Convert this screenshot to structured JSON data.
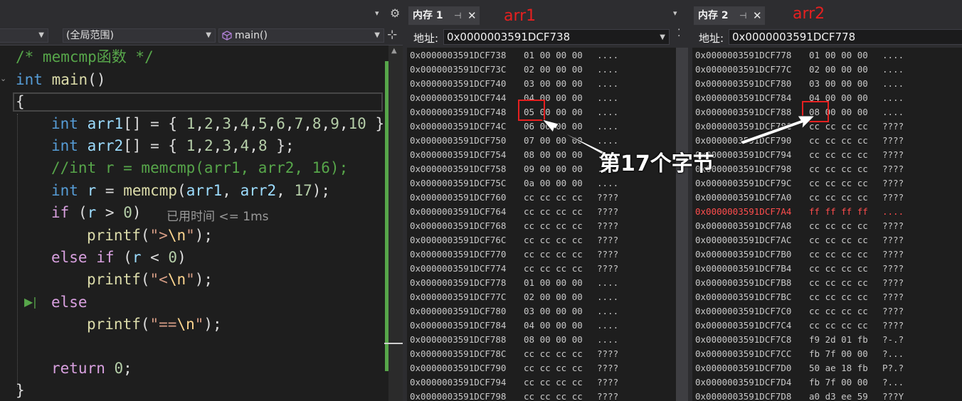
{
  "editor": {
    "scope_dropdown": "(全局范围)",
    "function_dropdown": "main()",
    "code_lines": [
      "/* memcmp函数 */",
      "int main()",
      "{",
      "int arr1[] = { 1,2,3,4,5,6,7,8,9,10 };",
      "int arr2[] = { 1,2,3,4,8 };",
      "//int r = memcmp(arr1, arr2, 16);",
      "int r = memcmp(arr1, arr2, 17);",
      "if (r > 0)",
      "printf(\">\\n\");",
      "else if (r < 0)",
      "printf(\"<\\n\");",
      "else",
      "printf(\"==\\n\");",
      "",
      "return 0;",
      "}"
    ],
    "perf_tip": "已用时间 <= 1ms",
    "current_line_marker": "▶|"
  },
  "memory1": {
    "tab_label": "内存 1",
    "pin": "⊣",
    "close": "✕",
    "address_label": "地址:",
    "address_value": "0x0000003591DCF738",
    "annotation": "arr1",
    "rows": [
      {
        "addr": "0x0000003591DCF738",
        "hex": "01 00 00 00",
        "ascii": "...."
      },
      {
        "addr": "0x0000003591DCF73C",
        "hex": "02 00 00 00",
        "ascii": "...."
      },
      {
        "addr": "0x0000003591DCF740",
        "hex": "03 00 00 00",
        "ascii": "...."
      },
      {
        "addr": "0x0000003591DCF744",
        "hex": "04 00 00 00",
        "ascii": "...."
      },
      {
        "addr": "0x0000003591DCF748",
        "hex": "05 00 00 00",
        "ascii": "...."
      },
      {
        "addr": "0x0000003591DCF74C",
        "hex": "06 00 00 00",
        "ascii": "...."
      },
      {
        "addr": "0x0000003591DCF750",
        "hex": "07 00 00 00",
        "ascii": "...."
      },
      {
        "addr": "0x0000003591DCF754",
        "hex": "08 00 00 00",
        "ascii": "...."
      },
      {
        "addr": "0x0000003591DCF758",
        "hex": "09 00 00 00",
        "ascii": "...."
      },
      {
        "addr": "0x0000003591DCF75C",
        "hex": "0a 00 00 00",
        "ascii": "...."
      },
      {
        "addr": "0x0000003591DCF760",
        "hex": "cc cc cc cc",
        "ascii": "????"
      },
      {
        "addr": "0x0000003591DCF764",
        "hex": "cc cc cc cc",
        "ascii": "????"
      },
      {
        "addr": "0x0000003591DCF768",
        "hex": "cc cc cc cc",
        "ascii": "????"
      },
      {
        "addr": "0x0000003591DCF76C",
        "hex": "cc cc cc cc",
        "ascii": "????"
      },
      {
        "addr": "0x0000003591DCF770",
        "hex": "cc cc cc cc",
        "ascii": "????"
      },
      {
        "addr": "0x0000003591DCF774",
        "hex": "cc cc cc cc",
        "ascii": "????"
      },
      {
        "addr": "0x0000003591DCF778",
        "hex": "01 00 00 00",
        "ascii": "...."
      },
      {
        "addr": "0x0000003591DCF77C",
        "hex": "02 00 00 00",
        "ascii": "...."
      },
      {
        "addr": "0x0000003591DCF780",
        "hex": "03 00 00 00",
        "ascii": "...."
      },
      {
        "addr": "0x0000003591DCF784",
        "hex": "04 00 00 00",
        "ascii": "...."
      },
      {
        "addr": "0x0000003591DCF788",
        "hex": "08 00 00 00",
        "ascii": "...."
      },
      {
        "addr": "0x0000003591DCF78C",
        "hex": "cc cc cc cc",
        "ascii": "????"
      },
      {
        "addr": "0x0000003591DCF790",
        "hex": "cc cc cc cc",
        "ascii": "????"
      },
      {
        "addr": "0x0000003591DCF794",
        "hex": "cc cc cc cc",
        "ascii": "????"
      },
      {
        "addr": "0x0000003591DCF798",
        "hex": "cc cc cc cc",
        "ascii": "????"
      }
    ]
  },
  "memory2": {
    "tab_label": "内存 2",
    "pin": "⊣",
    "close": "✕",
    "address_label": "地址:",
    "address_value": "0x0000003591DCF778",
    "annotation": "arr2",
    "rows": [
      {
        "addr": "0x0000003591DCF778",
        "hex": "01 00 00 00",
        "ascii": "...."
      },
      {
        "addr": "0x0000003591DCF77C",
        "hex": "02 00 00 00",
        "ascii": "...."
      },
      {
        "addr": "0x0000003591DCF780",
        "hex": "03 00 00 00",
        "ascii": "...."
      },
      {
        "addr": "0x0000003591DCF784",
        "hex": "04 00 00 00",
        "ascii": "...."
      },
      {
        "addr": "0x0000003591DCF788",
        "hex": "08 00 00 00",
        "ascii": "...."
      },
      {
        "addr": "0x0000003591DCF78C",
        "hex": "cc cc cc cc",
        "ascii": "????"
      },
      {
        "addr": "0x0000003591DCF790",
        "hex": "cc cc cc cc",
        "ascii": "????"
      },
      {
        "addr": "0x0000003591DCF794",
        "hex": "cc cc cc cc",
        "ascii": "????"
      },
      {
        "addr": "0x0000003591DCF798",
        "hex": "cc cc cc cc",
        "ascii": "????"
      },
      {
        "addr": "0x0000003591DCF79C",
        "hex": "cc cc cc cc",
        "ascii": "????"
      },
      {
        "addr": "0x0000003591DCF7A0",
        "hex": "cc cc cc cc",
        "ascii": "????"
      },
      {
        "addr": "0x0000003591DCF7A4",
        "hex": "ff ff ff ff",
        "ascii": "....",
        "changed": true
      },
      {
        "addr": "0x0000003591DCF7A8",
        "hex": "cc cc cc cc",
        "ascii": "????"
      },
      {
        "addr": "0x0000003591DCF7AC",
        "hex": "cc cc cc cc",
        "ascii": "????"
      },
      {
        "addr": "0x0000003591DCF7B0",
        "hex": "cc cc cc cc",
        "ascii": "????"
      },
      {
        "addr": "0x0000003591DCF7B4",
        "hex": "cc cc cc cc",
        "ascii": "????"
      },
      {
        "addr": "0x0000003591DCF7B8",
        "hex": "cc cc cc cc",
        "ascii": "????"
      },
      {
        "addr": "0x0000003591DCF7BC",
        "hex": "cc cc cc cc",
        "ascii": "????"
      },
      {
        "addr": "0x0000003591DCF7C0",
        "hex": "cc cc cc cc",
        "ascii": "????"
      },
      {
        "addr": "0x0000003591DCF7C4",
        "hex": "cc cc cc cc",
        "ascii": "????"
      },
      {
        "addr": "0x0000003591DCF7C8",
        "hex": "f9 2d 01 fb",
        "ascii": "?-.?"
      },
      {
        "addr": "0x0000003591DCF7CC",
        "hex": "fb 7f 00 00",
        "ascii": "?..."
      },
      {
        "addr": "0x0000003591DCF7D0",
        "hex": "50 ae 18 fb",
        "ascii": "P?.?"
      },
      {
        "addr": "0x0000003591DCF7D4",
        "hex": "fb 7f 00 00",
        "ascii": "?..."
      },
      {
        "addr": "0x0000003591DCF7D8",
        "hex": "a0 d3 ee 59",
        "ascii": "???Y"
      }
    ]
  },
  "annotation": {
    "text": "第17个字节"
  },
  "colors": {
    "annotation_red": "#e52020",
    "changed_value": "#ff4d4d",
    "breakpoint_bar": "#57a64a"
  },
  "icons": {
    "settings": "gear-icon",
    "dropdown": "chevron-down-icon",
    "function": "cube-icon",
    "split": "split-icon",
    "pin": "pin-icon",
    "close": "close-icon"
  }
}
